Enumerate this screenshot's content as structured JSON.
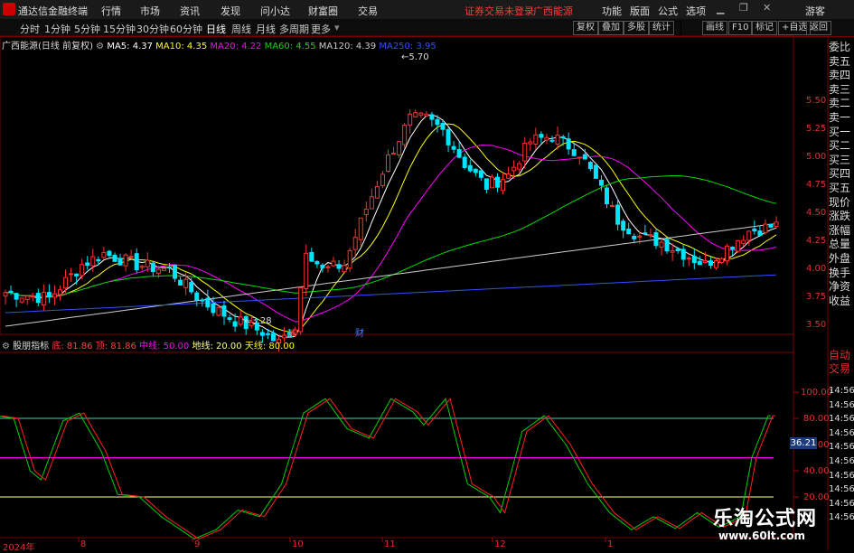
{
  "titlebar": {
    "app_name": "通达信金融终端",
    "menu": [
      "行情",
      "市场",
      "资讯",
      "发现",
      "问小达",
      "财富圈",
      "交易"
    ],
    "status": "证券交易未登录",
    "stock": "广西能源",
    "right_menu": [
      "功能",
      "版面",
      "公式",
      "选项"
    ],
    "guest": "游客"
  },
  "periodbar": {
    "periods": [
      "分时",
      "1分钟",
      "5分钟",
      "15分钟",
      "30分钟",
      "60分钟",
      "日线",
      "周线",
      "月线",
      "多周期",
      "更多"
    ],
    "active": "日线",
    "tools": [
      "复权",
      "叠加",
      "多股",
      "统计",
      "画线",
      "F10",
      "标记",
      "+自选",
      "返回"
    ]
  },
  "main_chart": {
    "title": "广西能源(日线 前复权)",
    "ma_labels": [
      {
        "text": "MA5: 4.37",
        "color": "#ffffff"
      },
      {
        "text": "MA10: 4.35",
        "color": "#ffff00"
      },
      {
        "text": "MA20: 4.22",
        "color": "#ff00ff"
      },
      {
        "text": "MA60: 4.55",
        "color": "#00dd00"
      },
      {
        "text": "MA120: 4.39",
        "color": "#cccccc"
      },
      {
        "text": "MA250: 3.95",
        "color": "#3050ff"
      }
    ],
    "y_ticks": [
      "5.50",
      "5.25",
      "5.00",
      "4.75",
      "4.50",
      "4.25",
      "4.00",
      "3.75",
      "3.50"
    ],
    "high_label": "5.70",
    "low_label": "3.28",
    "event_labels": [
      "减",
      "财"
    ]
  },
  "oscillator": {
    "title": "股朋指标",
    "labels": [
      {
        "text": "底: 81.86",
        "color": "#ff4040"
      },
      {
        "text": "顶: 81.86",
        "color": "#ff4040"
      },
      {
        "text": "中线: 50.00",
        "color": "#ff00ff"
      },
      {
        "text": "地线: 20.00",
        "color": "#ffff80"
      },
      {
        "text": "天线: 80.00",
        "color": "#ffff00"
      }
    ],
    "y_ticks": [
      "100.00",
      "80.00",
      "60.00",
      "40.00",
      "20.00"
    ],
    "value_box": "36.21",
    "levels": {
      "upper": 80,
      "middle": 50,
      "lower": 20
    }
  },
  "x_axis": [
    "2024年",
    "8",
    "9",
    "10",
    "11",
    "12",
    "1"
  ],
  "right_panel": {
    "top_labels": [
      "委比",
      "卖五",
      "卖四",
      "卖三",
      "卖二",
      "卖一",
      "买一",
      "买二",
      "买三",
      "买四",
      "买五",
      "现价",
      "涨跌",
      "涨幅",
      "总量",
      "外盘",
      "换手",
      "净资",
      "收益"
    ],
    "bottom_labels": [
      "自动",
      "交易"
    ],
    "times": [
      "14:56",
      "14:56",
      "14:56",
      "14:56",
      "14:56",
      "14:56",
      "14:56",
      "14:56",
      "14:56",
      "14:56"
    ]
  },
  "watermark": {
    "title": "乐淘公式网",
    "url": "www.60lt.com"
  }
}
